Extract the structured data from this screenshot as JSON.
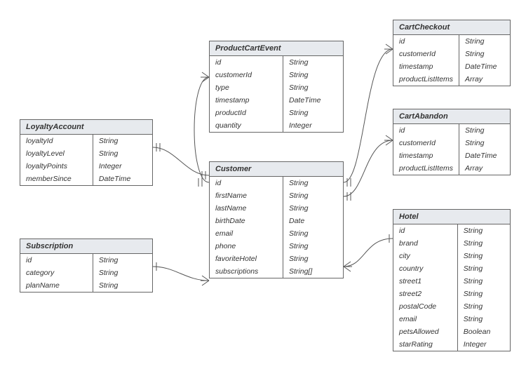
{
  "entities": {
    "loyalty": {
      "title": "LoyaltyAccount",
      "fields": [
        {
          "name": "loyaltyId",
          "type": "String"
        },
        {
          "name": "loyaltyLevel",
          "type": "String"
        },
        {
          "name": "loyaltyPoints",
          "type": "Integer"
        },
        {
          "name": "memberSince",
          "type": "DateTime"
        }
      ]
    },
    "subscription": {
      "title": "Subscription",
      "fields": [
        {
          "name": "id",
          "type": "String"
        },
        {
          "name": "category",
          "type": "String"
        },
        {
          "name": "planName",
          "type": "String"
        }
      ]
    },
    "productCartEvent": {
      "title": "ProductCartEvent",
      "fields": [
        {
          "name": "id",
          "type": "String"
        },
        {
          "name": "customerId",
          "type": "String"
        },
        {
          "name": "type",
          "type": "String"
        },
        {
          "name": "timestamp",
          "type": "DateTime"
        },
        {
          "name": "productId",
          "type": "String"
        },
        {
          "name": "quantity",
          "type": "Integer"
        }
      ]
    },
    "customer": {
      "title": "Customer",
      "fields": [
        {
          "name": "id",
          "type": "String"
        },
        {
          "name": "firstName",
          "type": "String"
        },
        {
          "name": "lastName",
          "type": "String"
        },
        {
          "name": "birthDate",
          "type": "Date"
        },
        {
          "name": "email",
          "type": "String"
        },
        {
          "name": "phone",
          "type": "String"
        },
        {
          "name": "favoriteHotel",
          "type": "String"
        },
        {
          "name": "subscriptions",
          "type": "String[]"
        }
      ]
    },
    "cartCheckout": {
      "title": "CartCheckout",
      "fields": [
        {
          "name": "id",
          "type": "String"
        },
        {
          "name": "customerId",
          "type": "String"
        },
        {
          "name": "timestamp",
          "type": "DateTime"
        },
        {
          "name": "productListItems",
          "type": "Array"
        }
      ]
    },
    "cartAbandon": {
      "title": "CartAbandon",
      "fields": [
        {
          "name": "id",
          "type": "String"
        },
        {
          "name": "customerId",
          "type": "String"
        },
        {
          "name": "timestamp",
          "type": "DateTime"
        },
        {
          "name": "productListItems",
          "type": "Array"
        }
      ]
    },
    "hotel": {
      "title": "Hotel",
      "fields": [
        {
          "name": "id",
          "type": "String"
        },
        {
          "name": "brand",
          "type": "String"
        },
        {
          "name": "city",
          "type": "String"
        },
        {
          "name": "country",
          "type": "String"
        },
        {
          "name": "street1",
          "type": "String"
        },
        {
          "name": "street2",
          "type": "String"
        },
        {
          "name": "postalCode",
          "type": "String"
        },
        {
          "name": "email",
          "type": "String"
        },
        {
          "name": "petsAllowed",
          "type": "Boolean"
        },
        {
          "name": "starRating",
          "type": "Integer"
        }
      ]
    }
  }
}
